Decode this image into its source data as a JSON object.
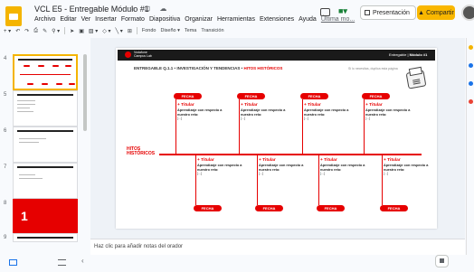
{
  "window": {
    "doc_title": "VCL E5 - Entregable Módulo #1",
    "title_icons": "☆ ⊡ ☁"
  },
  "menu": [
    "Archivo",
    "Editar",
    "Ver",
    "Insertar",
    "Formato",
    "Diapositiva",
    "Organizar",
    "Herramientas",
    "Extensiones",
    "Ayuda"
  ],
  "menu_last_edit": "Última mo...",
  "header_actions": {
    "present_label": "Presentación",
    "share_label": "Compartir"
  },
  "toolbar": {
    "fondo": "Fondo",
    "diseno": "Diseño ▾",
    "tema": "Tema",
    "transicion": "Transición"
  },
  "filmstrip": {
    "slide_numbers": [
      "4",
      "5",
      "6",
      "7",
      "8",
      "9"
    ]
  },
  "slide": {
    "brand_name": "Vodafone Campus Lab",
    "entregable_prefix": "Entregable |",
    "entregable_number": "Módulo #1",
    "subtitle_main": "ENTREGABLE Q.1.1 • INVESTIGACIÓN Y TENDENCIAS • ",
    "subtitle_highlight": "HITOS HISTÓRICOS",
    "hint": "Si lo necesitas, duplica esta página",
    "axis_label_line1": "HITOS",
    "axis_label_line2": "HISTÓRICOS",
    "top_cards": [
      {
        "fecha": "FECHA",
        "title": "Titular",
        "sub": "Aprendizaje con respecto a nuestro reto:",
        "ellipsis": "[...]"
      },
      {
        "fecha": "FECHA",
        "title": "Titular",
        "sub": "Aprendizaje con respecto a nuestro reto:",
        "ellipsis": "[...]"
      },
      {
        "fecha": "FECHA",
        "title": "Titular",
        "sub": "Aprendizaje con respecto a nuestro reto:",
        "ellipsis": "[...]"
      },
      {
        "fecha": "FECHA",
        "title": "Titular",
        "sub": "Aprendizaje con respecto a nuestro reto:",
        "ellipsis": "[...]"
      }
    ],
    "bottom_cards": [
      {
        "fecha": "FECHA",
        "title": "Titular",
        "sub": "Aprendizaje con respecto a nuestro reto:",
        "ellipsis": "[...]"
      },
      {
        "fecha": "FECHA",
        "title": "Titular",
        "sub": "Aprendizaje con respecto a nuestro reto:",
        "ellipsis": "[...]"
      },
      {
        "fecha": "FECHA",
        "title": "Titular",
        "sub": "Aprendizaje con respecto a nuestro reto:",
        "ellipsis": "[...]"
      },
      {
        "fecha": "FECHA",
        "title": "Titular",
        "sub": "Aprendizaje con respecto a nuestro reto:",
        "ellipsis": "[...]"
      }
    ]
  },
  "notes": {
    "placeholder": "Haz clic para añadir notas del orador"
  },
  "colors": {
    "accent": "#e60000",
    "share": "#f9b700",
    "selection": "#f4b400"
  }
}
